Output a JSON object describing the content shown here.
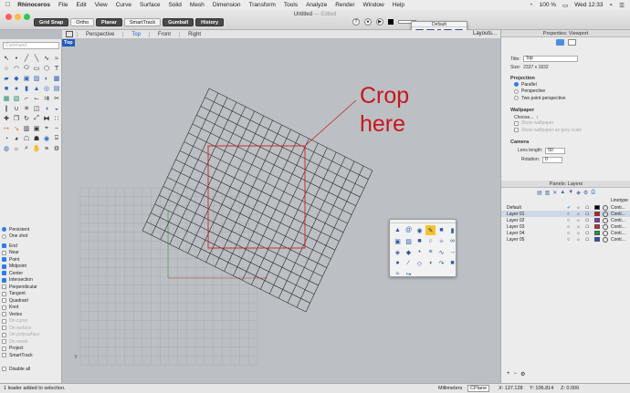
{
  "menubar": {
    "app": "Rhinoceros",
    "items": [
      "File",
      "Edit",
      "View",
      "Curve",
      "Surface",
      "Solid",
      "Mesh",
      "Dimension",
      "Transform",
      "Tools",
      "Analyze",
      "Render",
      "Window",
      "Help"
    ],
    "battery": "100 %",
    "clock": "Wed 12:33"
  },
  "titlebar": {
    "doc_title": "Untitled",
    "doc_sub": "— Edited",
    "osnap_buttons": [
      {
        "label": "Grid Snap",
        "active": true
      },
      {
        "label": "Ortho",
        "active": false
      },
      {
        "label": "Planar",
        "active": true
      },
      {
        "label": "SmartTrack",
        "active": false
      },
      {
        "label": "Gumball",
        "active": true
      },
      {
        "label": "History",
        "active": true
      }
    ],
    "default_palette": "Default"
  },
  "viewport_tabs": [
    "Perspective",
    "Top",
    "Front",
    "Right"
  ],
  "active_tab": "Top",
  "layouts_label": "Layouts...",
  "viewport_label": "Top",
  "annotation": {
    "line1": "Crop",
    "line2": "here",
    "color": "#c8161d"
  },
  "command_placeholder": "Command",
  "osnaps": {
    "mode": [
      {
        "label": "Persistent",
        "on": true
      },
      {
        "label": "One shot",
        "on": false
      }
    ],
    "items": [
      {
        "label": "End",
        "on": true,
        "enabled": true
      },
      {
        "label": "Near",
        "on": false,
        "enabled": true
      },
      {
        "label": "Point",
        "on": true,
        "enabled": true
      },
      {
        "label": "Midpoint",
        "on": true,
        "enabled": true
      },
      {
        "label": "Center",
        "on": true,
        "enabled": true
      },
      {
        "label": "Intersection",
        "on": true,
        "enabled": true
      },
      {
        "label": "Perpendicular",
        "on": false,
        "enabled": true
      },
      {
        "label": "Tangent",
        "on": false,
        "enabled": true
      },
      {
        "label": "Quadrant",
        "on": false,
        "enabled": true
      },
      {
        "label": "Knot",
        "on": false,
        "enabled": true
      },
      {
        "label": "Vertex",
        "on": false,
        "enabled": true
      },
      {
        "label": "On curve",
        "on": false,
        "enabled": false
      },
      {
        "label": "On surface",
        "on": false,
        "enabled": false
      },
      {
        "label": "On polysurface",
        "on": false,
        "enabled": false
      },
      {
        "label": "On mesh",
        "on": false,
        "enabled": false
      },
      {
        "label": "Project",
        "on": false,
        "enabled": true
      },
      {
        "label": "SmartTrack",
        "on": false,
        "enabled": true
      }
    ],
    "disable_all": "Disable all"
  },
  "properties": {
    "header": "Properties: Viewport",
    "title_label": "Title:",
    "title_value": "Top",
    "size_label": "Size:",
    "size_value": "2337 x 1832",
    "projection_title": "Projection",
    "projection_options": [
      {
        "label": "Parallel",
        "on": true
      },
      {
        "label": "Perspective",
        "on": false
      },
      {
        "label": "Two point perspective",
        "on": false
      }
    ],
    "wallpaper_title": "Wallpaper",
    "wallpaper_choose": "Choose...",
    "wallpaper_show": "Show wallpaper",
    "wallpaper_grey": "Show wallpaper as grey scale",
    "camera_title": "Camera",
    "lens_label": "Lens length:",
    "lens_value": "50",
    "rotation_label": "Rotation:",
    "rotation_value": "0"
  },
  "layers": {
    "header": "Panels: Layers",
    "col_linetype": "Linetype",
    "rows": [
      {
        "name": "Default",
        "color": "#000000",
        "linetype": "Conti...",
        "current": true,
        "selected": false
      },
      {
        "name": "Layer 01",
        "color": "#ff0000",
        "linetype": "Conti...",
        "current": false,
        "selected": true
      },
      {
        "name": "Layer 02",
        "color": "#8a2be2",
        "linetype": "Conti...",
        "current": false,
        "selected": false
      },
      {
        "name": "Layer 03",
        "color": "#e02222",
        "linetype": "Conti...",
        "current": false,
        "selected": false
      },
      {
        "name": "Layer 04",
        "color": "#16a040",
        "linetype": "Conti...",
        "current": false,
        "selected": false
      },
      {
        "name": "Layer 05",
        "color": "#1f4ed8",
        "linetype": "Conti...",
        "current": false,
        "selected": false
      }
    ]
  },
  "status": {
    "message": "1 leader added to selection.",
    "units": "Millimeters",
    "cplane": "CPlane",
    "x": "X: 137.128",
    "y": "Y: 106.814",
    "z": "Z: 0.000"
  }
}
